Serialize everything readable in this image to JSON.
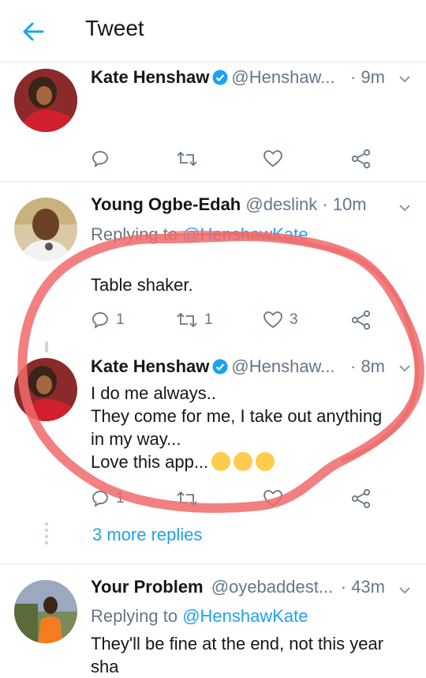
{
  "header": {
    "title": "Tweet"
  },
  "tweets": [
    {
      "name": "Kate Henshaw",
      "handle": "@Henshaw...",
      "time": "· 9m",
      "verified": true,
      "actions": {
        "reply": "",
        "retweet": "",
        "like": ""
      }
    },
    {
      "name": "Young Ogbe-Edah",
      "handle": "@deslink",
      "time": "· 10m",
      "reply_prefix": "Replying to ",
      "reply_to": "@HenshawKate",
      "text": "Table shaker.",
      "actions": {
        "reply": "1",
        "retweet": "1",
        "like": "3"
      }
    },
    {
      "name": "Kate Henshaw",
      "handle": "@Henshaw...",
      "time": "· 8m",
      "verified": true,
      "text_lines": [
        "I do me always..",
        "They come for me, I take out anything",
        "in my way...",
        "Love this app..."
      ],
      "actions": {
        "reply": "1",
        "retweet": "",
        "like": ""
      }
    },
    {
      "name": "Your Problem",
      "handle": "@oyebaddest...",
      "time": "· 43m",
      "reply_prefix": "Replying to ",
      "reply_to": "@HenshawKate",
      "text_lines": [
        "They'll be fine at the end, not this year",
        "sha"
      ]
    }
  ],
  "more_replies": "3 more replies",
  "colors": {
    "accent": "#1da1f2",
    "muted": "#657786",
    "scribble": "#f06a6a"
  }
}
